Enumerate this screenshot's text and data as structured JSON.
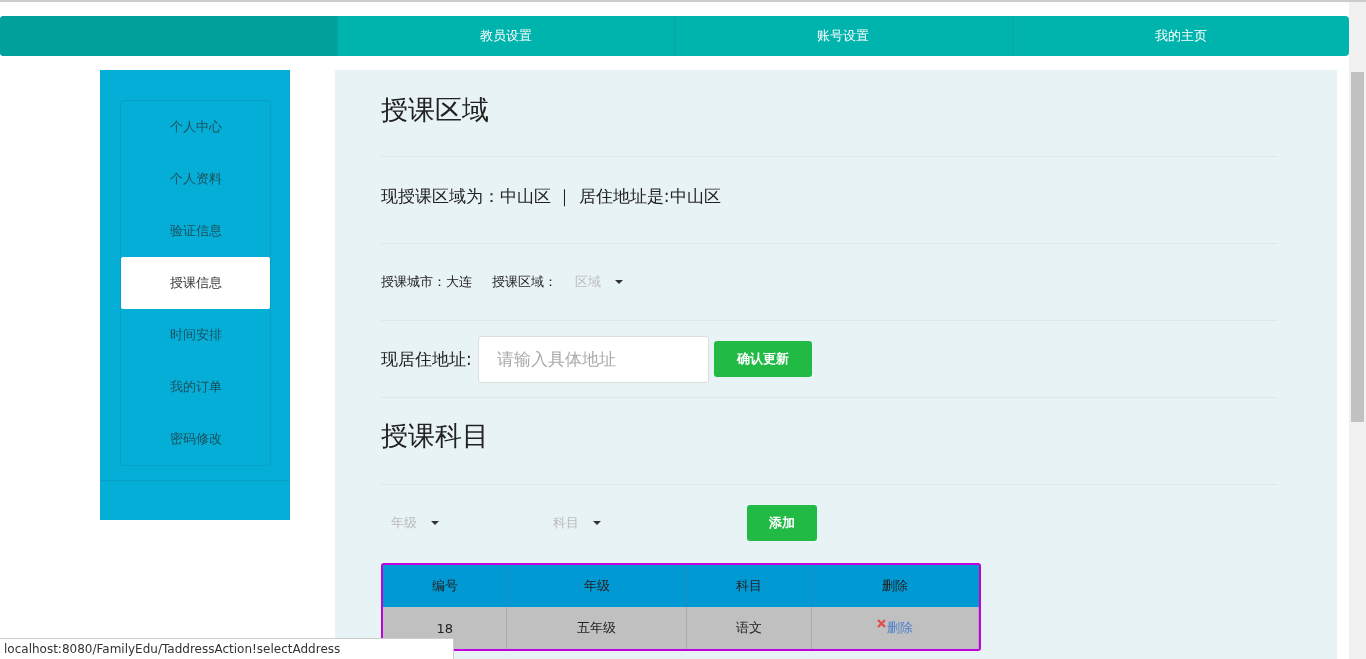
{
  "nav": {
    "tabs": [
      {
        "label": "教员设置",
        "selected": false
      },
      {
        "label": "账号设置",
        "selected": false
      },
      {
        "label": "我的主页",
        "selected": false
      }
    ]
  },
  "sidebar": {
    "items": [
      {
        "label": "个人中心",
        "selected": false
      },
      {
        "label": "个人资料",
        "selected": false
      },
      {
        "label": "验证信息",
        "selected": false
      },
      {
        "label": "授课信息",
        "selected": true
      },
      {
        "label": "时间安排",
        "selected": false
      },
      {
        "label": "我的订单",
        "selected": false
      },
      {
        "label": "密码修改",
        "selected": false
      }
    ]
  },
  "area": {
    "title": "授课区域",
    "current": "现授课区域为：中山区 ｜ 居住地址是:中山区",
    "city_label": "授课城市：大连",
    "district_label": "授课区域：",
    "district_select": "区域",
    "address_label": "现居住地址:",
    "address_field": {
      "placeholder": "请输入具体地址"
    },
    "update_button": "确认更新"
  },
  "subjects": {
    "title": "授课科目",
    "grade_select": "年级",
    "subject_select": "科目",
    "add_button": "添加",
    "table": {
      "columns": [
        "编号",
        "年级",
        "科目",
        "删除"
      ],
      "rows": [
        {
          "id": "18",
          "grade": "五年级",
          "subject": "语文",
          "action": "删除"
        }
      ]
    }
  },
  "status_bar": "localhost:8080/FamilyEdu/TaddressAction!selectAddress"
}
